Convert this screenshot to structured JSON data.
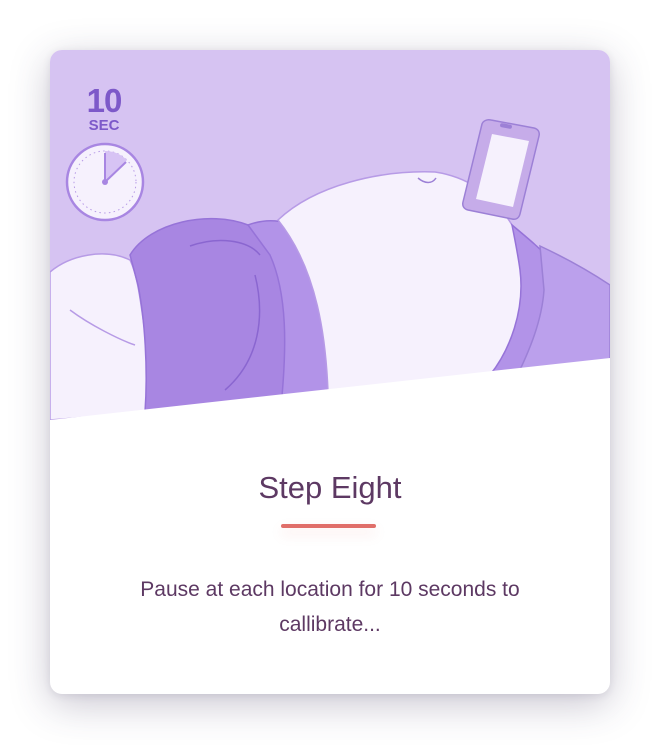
{
  "timer": {
    "value": "10",
    "unit": "SEC"
  },
  "step": {
    "title": "Step Eight",
    "description": "Pause at each location for 10 seconds to callibrate..."
  },
  "colors": {
    "illustration_background": "#d6c3f2",
    "accent_purple": "#7d59c9",
    "divider": "#e06f6a",
    "text": "#5d3963"
  },
  "icons": {
    "timer": "stopwatch-icon",
    "phone": "phone-icon"
  }
}
